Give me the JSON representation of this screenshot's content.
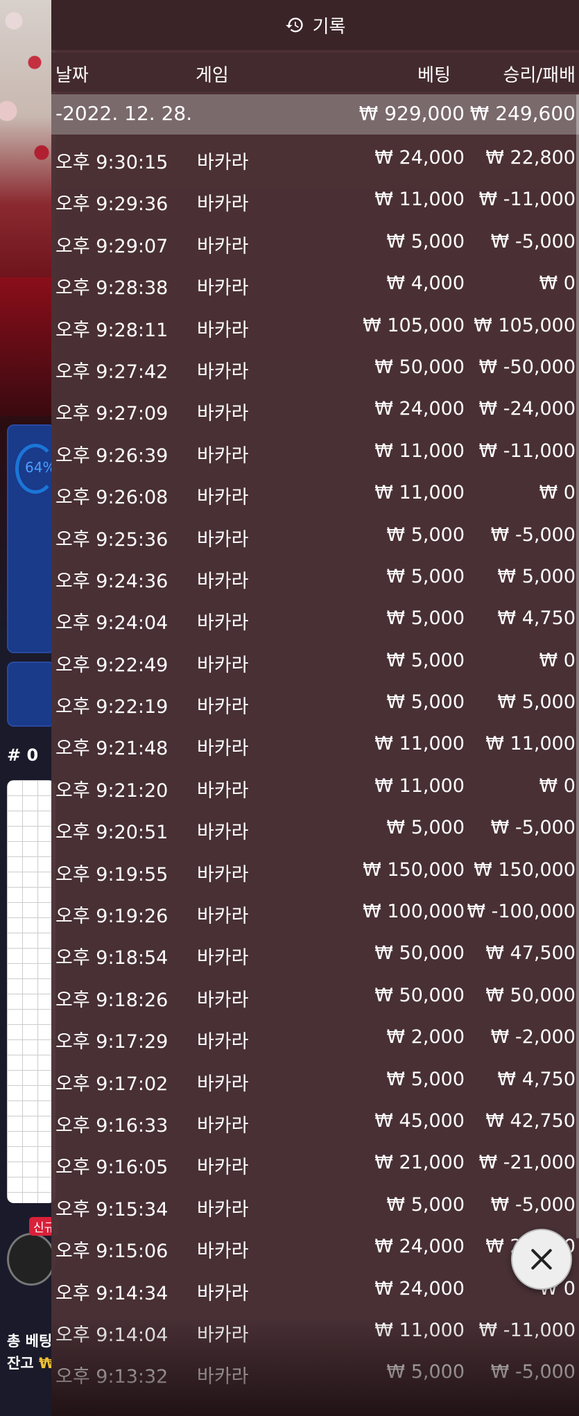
{
  "background": {
    "ring_percent": "64%",
    "hash_label": "# 0",
    "new_badge": "신규",
    "total_bet_label": "총 베팅",
    "balance_label": "잔고",
    "balance_value": "₩"
  },
  "header": {
    "title": "기록",
    "icon": "history-icon"
  },
  "columns": {
    "date": "날짜",
    "game": "게임",
    "bet": "베팅",
    "win_loss": "승리/패배"
  },
  "summary": {
    "date": "-2022. 12. 28.",
    "bet": "₩ 929,000",
    "win_loss": "₩ 249,600"
  },
  "rows": [
    {
      "time": "오후 9:30:15",
      "game": "바카라",
      "bet": "₩ 24,000",
      "result": "₩ 22,800"
    },
    {
      "time": "오후 9:29:36",
      "game": "바카라",
      "bet": "₩ 11,000",
      "result": "₩ -11,000"
    },
    {
      "time": "오후 9:29:07",
      "game": "바카라",
      "bet": "₩ 5,000",
      "result": "₩ -5,000"
    },
    {
      "time": "오후 9:28:38",
      "game": "바카라",
      "bet": "₩ 4,000",
      "result": "₩ 0"
    },
    {
      "time": "오후 9:28:11",
      "game": "바카라",
      "bet": "₩ 105,000",
      "result": "₩ 105,000"
    },
    {
      "time": "오후 9:27:42",
      "game": "바카라",
      "bet": "₩ 50,000",
      "result": "₩ -50,000"
    },
    {
      "time": "오후 9:27:09",
      "game": "바카라",
      "bet": "₩ 24,000",
      "result": "₩ -24,000"
    },
    {
      "time": "오후 9:26:39",
      "game": "바카라",
      "bet": "₩ 11,000",
      "result": "₩ -11,000"
    },
    {
      "time": "오후 9:26:08",
      "game": "바카라",
      "bet": "₩ 11,000",
      "result": "₩ 0"
    },
    {
      "time": "오후 9:25:36",
      "game": "바카라",
      "bet": "₩ 5,000",
      "result": "₩ -5,000"
    },
    {
      "time": "오후 9:24:36",
      "game": "바카라",
      "bet": "₩ 5,000",
      "result": "₩ 5,000"
    },
    {
      "time": "오후 9:24:04",
      "game": "바카라",
      "bet": "₩ 5,000",
      "result": "₩ 4,750"
    },
    {
      "time": "오후 9:22:49",
      "game": "바카라",
      "bet": "₩ 5,000",
      "result": "₩ 0"
    },
    {
      "time": "오후 9:22:19",
      "game": "바카라",
      "bet": "₩ 5,000",
      "result": "₩ 5,000"
    },
    {
      "time": "오후 9:21:48",
      "game": "바카라",
      "bet": "₩ 11,000",
      "result": "₩ 11,000"
    },
    {
      "time": "오후 9:21:20",
      "game": "바카라",
      "bet": "₩ 11,000",
      "result": "₩ 0"
    },
    {
      "time": "오후 9:20:51",
      "game": "바카라",
      "bet": "₩ 5,000",
      "result": "₩ -5,000"
    },
    {
      "time": "오후 9:19:55",
      "game": "바카라",
      "bet": "₩ 150,000",
      "result": "₩ 150,000"
    },
    {
      "time": "오후 9:19:26",
      "game": "바카라",
      "bet": "₩ 100,000",
      "result": "₩ -100,000"
    },
    {
      "time": "오후 9:18:54",
      "game": "바카라",
      "bet": "₩ 50,000",
      "result": "₩ 47,500"
    },
    {
      "time": "오후 9:18:26",
      "game": "바카라",
      "bet": "₩ 50,000",
      "result": "₩ 50,000"
    },
    {
      "time": "오후 9:17:29",
      "game": "바카라",
      "bet": "₩ 2,000",
      "result": "₩ -2,000"
    },
    {
      "time": "오후 9:17:02",
      "game": "바카라",
      "bet": "₩ 5,000",
      "result": "₩ 4,750"
    },
    {
      "time": "오후 9:16:33",
      "game": "바카라",
      "bet": "₩ 45,000",
      "result": "₩ 42,750"
    },
    {
      "time": "오후 9:16:05",
      "game": "바카라",
      "bet": "₩ 21,000",
      "result": "₩ -21,000"
    },
    {
      "time": "오후 9:15:34",
      "game": "바카라",
      "bet": "₩ 5,000",
      "result": "₩ -5,000"
    },
    {
      "time": "오후 9:15:06",
      "game": "바카라",
      "bet": "₩ 24,000",
      "result": "₩ 24,000"
    },
    {
      "time": "오후 9:14:34",
      "game": "바카라",
      "bet": "₩ 24,000",
      "result": "₩ 0"
    },
    {
      "time": "오후 9:14:04",
      "game": "바카라",
      "bet": "₩ 11,000",
      "result": "₩ -11,000"
    },
    {
      "time": "오후 9:13:32",
      "game": "바카라",
      "bet": "₩ 5,000",
      "result": "₩ -5,000"
    }
  ],
  "close_button": {
    "icon": "close-icon"
  }
}
